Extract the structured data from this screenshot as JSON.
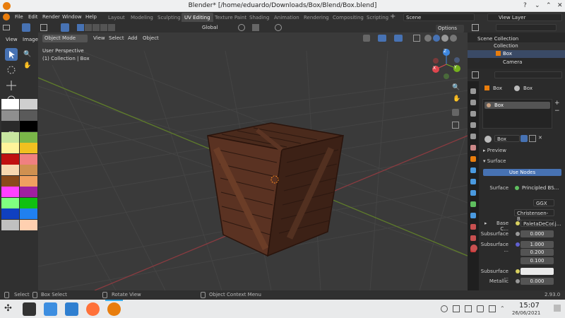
{
  "window": {
    "title": "Blender* [/home/eduardo/Downloads/Box/Blend/Box.blend]",
    "close": "✕",
    "minimize": "⌄",
    "maximize": "⌃",
    "help": "?"
  },
  "menu": [
    "File",
    "Edit",
    "Render",
    "Window",
    "Help"
  ],
  "workspaces": [
    "Layout",
    "Modeling",
    "Sculpting",
    "UV Editing",
    "Texture Paint",
    "Shading",
    "Animation",
    "Rendering",
    "Compositing",
    "Scripting"
  ],
  "active_workspace": "UV Editing",
  "add_workspace": "+",
  "scene": "Scene",
  "view_layer": "View Layer",
  "uv_panel": {
    "menu": [
      "View",
      "Image"
    ]
  },
  "viewport": {
    "mode": "Object Mode",
    "menu": [
      "View",
      "Select",
      "Add",
      "Object"
    ],
    "orientation": "Global",
    "options": "Options",
    "info_line1": "User Perspective",
    "info_line2": "(1) Collection | Box"
  },
  "gizmo_axes": {
    "x": "X",
    "y": "Y",
    "z": "Z"
  },
  "outliner": {
    "root": "Scene Collection",
    "items": [
      "Collection",
      "Box",
      "Camera"
    ]
  },
  "properties": {
    "object": "Box",
    "material_tab": "Box",
    "slot": "Box",
    "material_name": "Box",
    "preview": "Preview",
    "surface_section": "Surface",
    "use_nodes": "Use Nodes",
    "surface_label": "Surface",
    "surface_value": "Principled BS...",
    "distribution": "GGX",
    "subsurface_method": "Christensen-B...",
    "base_color_label": "Base C...",
    "base_color_value": "PaletaDeCor.j...",
    "subsurface_label": "Subsurface",
    "subsurface_value": "0.000",
    "subsurface_radius_label": "Subsurface ...",
    "radius": [
      "1.000",
      "0.200",
      "0.100"
    ],
    "subsurface_color_label": "Subsurface ...",
    "metallic_label": "Metallic",
    "metallic_value": "0.000"
  },
  "status": {
    "select": "Select",
    "box_select": "Box Select",
    "rotate": "Rotate View",
    "context": "Object Context Menu",
    "version": "2.93.0"
  },
  "taskbar": {
    "time": "15:07",
    "date": "26/06/2021"
  },
  "palette": [
    "#ffffff",
    "#cfcfcf",
    "#8f8f8f",
    "#5a5a5a",
    "#2a2a2a",
    "#000000",
    "#c8e6a0",
    "#7ab648",
    "#fff39a",
    "#f0c020",
    "#c01010",
    "#f08080",
    "#f8d8b0",
    "#d09050",
    "#8a4a1a",
    "#f0a060",
    "#ff40ff",
    "#a020a0",
    "#80ff80",
    "#10c010",
    "#1040c0",
    "#2080f0",
    "#c0c0c0",
    "#ffd0b0"
  ],
  "colors": {
    "accent": "#4772b3",
    "x_axis": "#e0464e",
    "y_axis": "#75b11c",
    "z_axis": "#3e87e0",
    "blender_orange": "#e87d0d"
  }
}
